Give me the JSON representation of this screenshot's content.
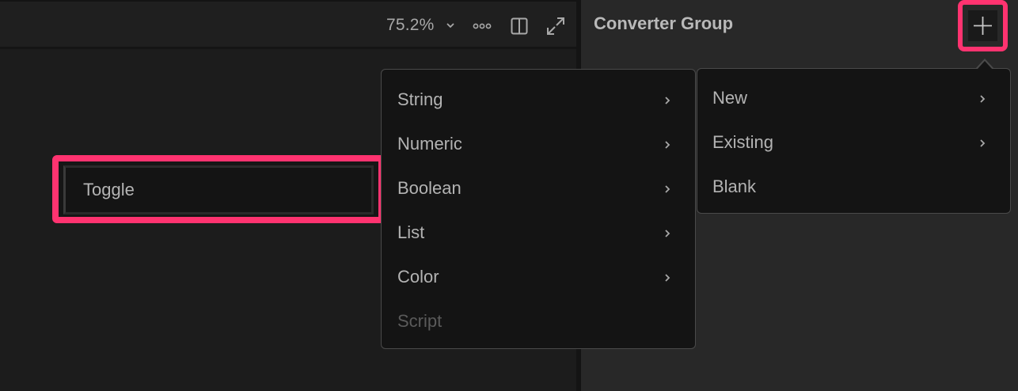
{
  "toolbar": {
    "zoom_label": "75.2%",
    "icons": [
      "chevron-down-icon",
      "more-icon",
      "panel-layout-icon",
      "expand-icon"
    ]
  },
  "right_panel": {
    "title": "Converter Group",
    "add_icon": "plus-icon"
  },
  "canvas": {
    "toggle_label": "Toggle"
  },
  "menu": {
    "items": [
      {
        "label": "String",
        "has_submenu": true,
        "disabled": false
      },
      {
        "label": "Numeric",
        "has_submenu": true,
        "disabled": false
      },
      {
        "label": "Boolean",
        "has_submenu": true,
        "disabled": false
      },
      {
        "label": "List",
        "has_submenu": true,
        "disabled": false
      },
      {
        "label": "Color",
        "has_submenu": true,
        "disabled": false
      },
      {
        "label": "Script",
        "has_submenu": false,
        "disabled": true
      }
    ]
  },
  "submenu": {
    "items": [
      {
        "label": "New",
        "has_submenu": true
      },
      {
        "label": "Existing",
        "has_submenu": true
      },
      {
        "label": "Blank",
        "has_submenu": false
      }
    ]
  },
  "colors": {
    "highlight": "#ff3370",
    "menu_bg": "#141414",
    "panel_bg": "#282828"
  }
}
